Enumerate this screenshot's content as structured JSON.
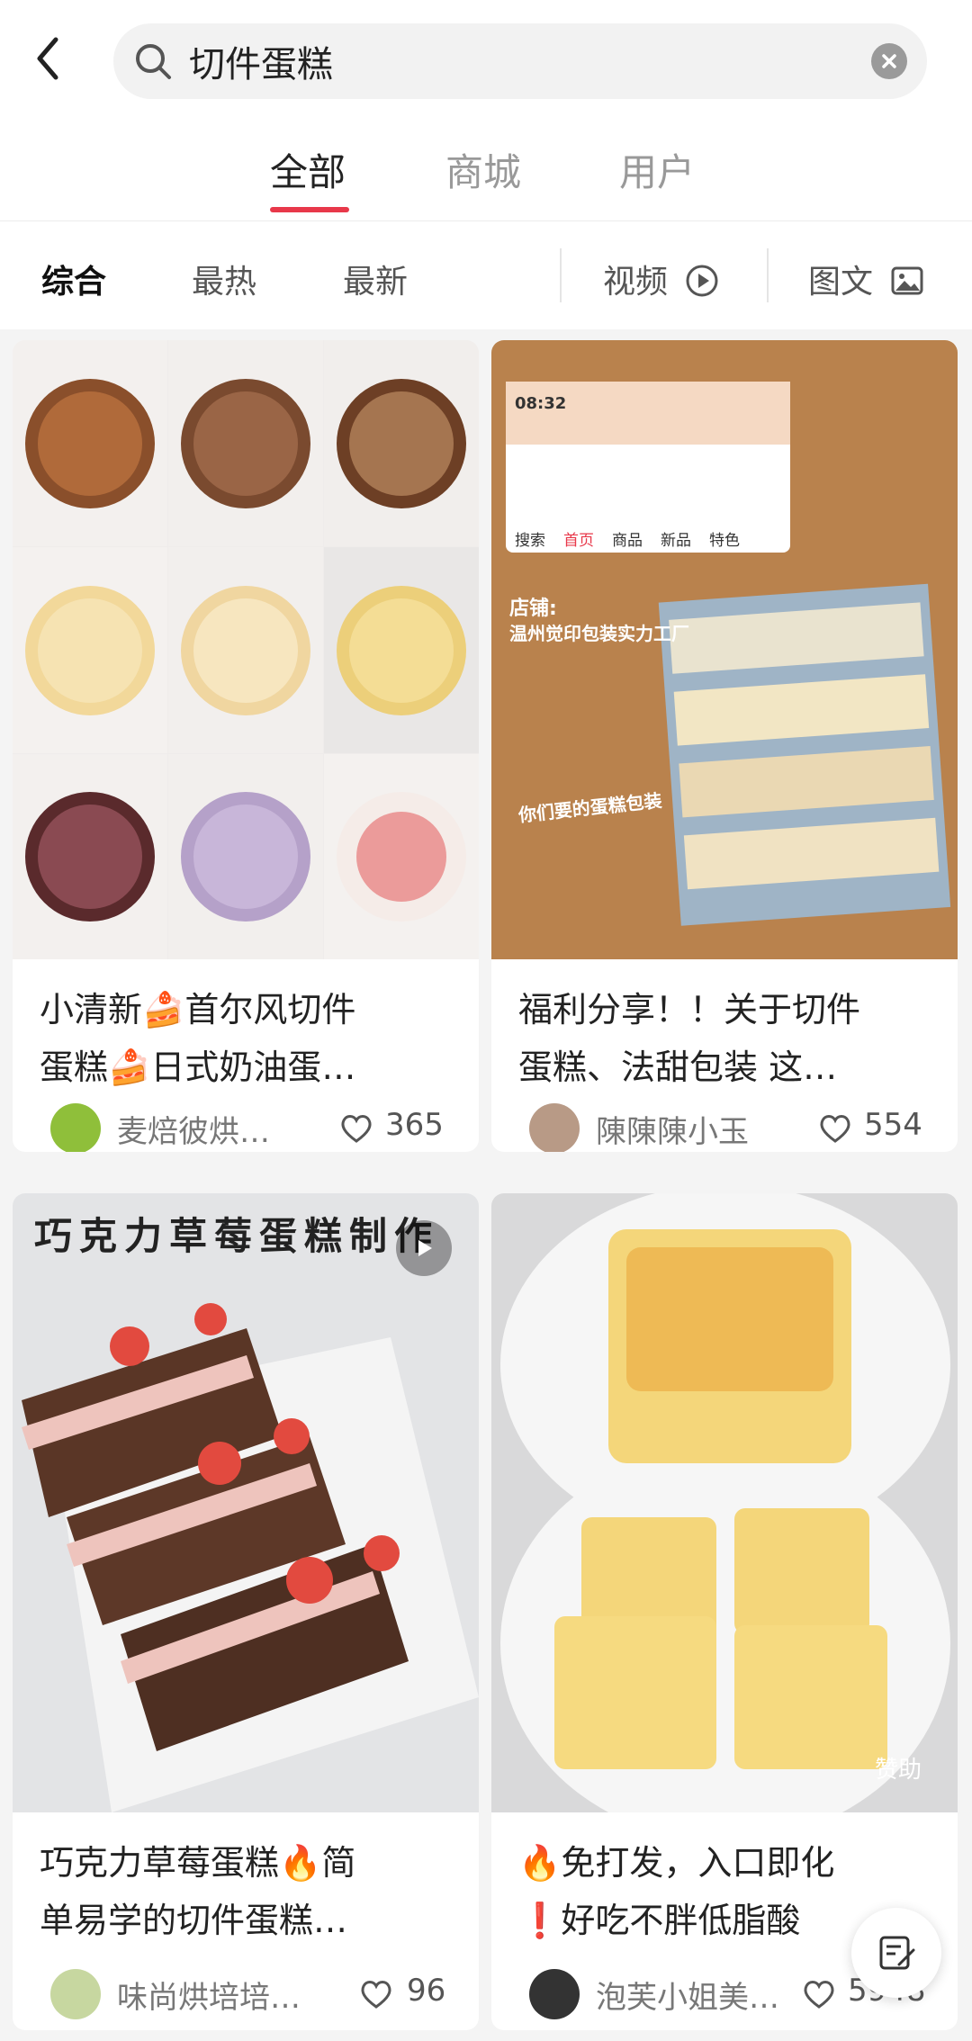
{
  "search": {
    "query": "切件蛋糕"
  },
  "tabs": [
    {
      "label": "全部",
      "active": true
    },
    {
      "label": "商城",
      "active": false
    },
    {
      "label": "用户",
      "active": false
    }
  ],
  "filters": {
    "sort": [
      "综合",
      "最热",
      "最新"
    ],
    "video_label": "视频",
    "image_text_label": "图文"
  },
  "cards": [
    {
      "title_line1": "小清新🍰首尔风切件",
      "title_line2": "蛋糕🍰日式奶油蛋…",
      "author": "麦焙彼烘…",
      "likes": "365",
      "avatar_color": "#8fbf3a"
    },
    {
      "title_line1": "福利分享！！关于切件",
      "title_line2": "蛋糕、法甜包装 这…",
      "author": "陳陳陳小玉",
      "likes": "554",
      "avatar_color": "#b89a86",
      "image_overlay": {
        "shop_label": "店铺:",
        "shop_name": "温州觉印包装实力工厂",
        "caption": "你们要的蛋糕包装",
        "phone_time": "08:32",
        "phone_tabs": [
          "搜索",
          "首页",
          "商品",
          "新品",
          "特色"
        ]
      }
    },
    {
      "title_line1": "巧克力草莓蛋糕🔥简",
      "title_line2": "单易学的切件蛋糕…",
      "author": "味尚烘培培…",
      "likes": "96",
      "avatar_color": "#c7d7a0",
      "image_overlay": {
        "headline": "巧克力草莓蛋糕制作"
      }
    },
    {
      "title_line1": "🔥免打发，入口即化",
      "title_line2": "❗好吃不胖低脂酸",
      "author": "泡芙小姐美…",
      "likes": "5948",
      "avatar_color": "#333333",
      "image_overlay": {
        "badge": "赞助"
      }
    }
  ],
  "colors": {
    "accent": "#e8384a",
    "bg": "#f4f4f4"
  }
}
